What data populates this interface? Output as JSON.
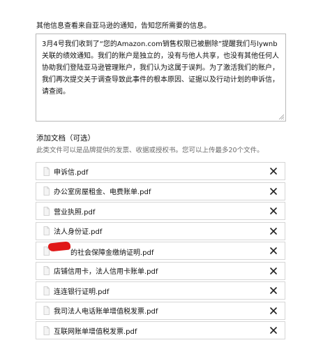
{
  "info": {
    "label": "其他信息查看来自亚马逊的通知，告知您所需要的信息。",
    "body": "3月4号我们收到了“您的Amazon.com销售权限已被删除”提醒我们与lywnb关联的绩效通知。我们的账户是独立的，没有与他人共享，也没有其他任何人协助我们登陆亚马逊管理账户，我们认为这属于误判。为了激活我们的账户，我们再次提交关于调查导致此事件的根本原因、证据以及行动计划的申诉信，请查阅。"
  },
  "documents": {
    "title": "添加文档（可选）",
    "hint": "此类文件可以是品牌提供的发票、收据或授权书。您可以上传最多20个文件。",
    "files": [
      {
        "name": "申诉信.pdf"
      },
      {
        "name": "办公室房屋租金、电费账单.pdf"
      },
      {
        "name": "营业执照.pdf"
      },
      {
        "name": "法人身份证.pdf"
      },
      {
        "name": "的社会保障金缴纳证明.pdf",
        "redacted_prefix": true
      },
      {
        "name": "店铺信用卡，法人信用卡账单.pdf"
      },
      {
        "name": "连连银行证明.pdf"
      },
      {
        "name": "我司法人电话账单增值税发票.pdf"
      },
      {
        "name": "互联网账单增值税发票.pdf"
      }
    ],
    "remove_icon": "close-icon",
    "file_icon": "document-icon"
  },
  "colors": {
    "border": "#d6d6d6",
    "hint_text": "#6b6b6b",
    "redaction": "#e01818"
  }
}
